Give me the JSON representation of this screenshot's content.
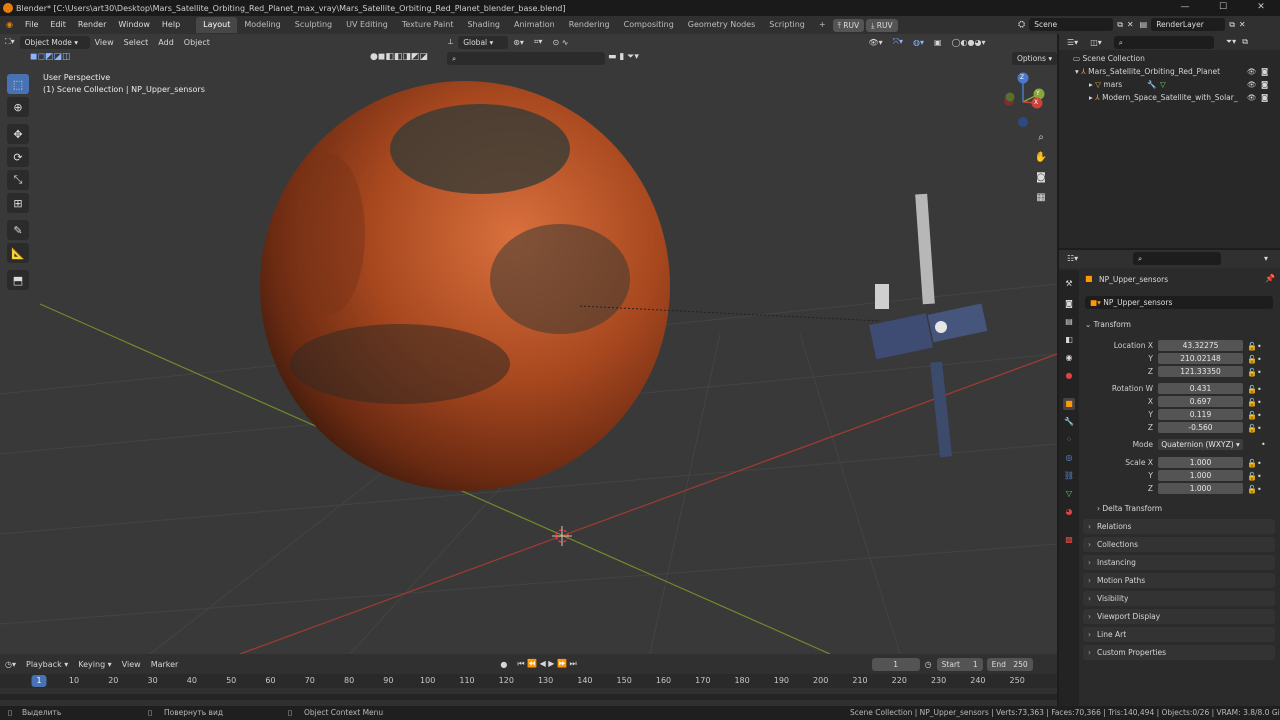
{
  "window": {
    "title": "Blender* [C:\\Users\\art30\\Desktop\\Mars_Satellite_Orbiting_Red_Planet_max_vray\\Mars_Satellite_Orbiting_Red_Planet_blender_base.blend]",
    "minimize": "—",
    "maximize": "☐",
    "close": "✕"
  },
  "menu": {
    "items": [
      "File",
      "Edit",
      "Render",
      "Window",
      "Help"
    ],
    "workspaces": [
      "Layout",
      "Modeling",
      "Sculpting",
      "UV Editing",
      "Texture Paint",
      "Shading",
      "Animation",
      "Rendering",
      "Compositing",
      "Geometry Nodes",
      "Scripting"
    ],
    "add_workspace": "+",
    "ruv1": "RUV",
    "ruv2": "RUV",
    "scene_label": "Scene",
    "render_layer": "RenderLayer"
  },
  "viewport": {
    "mode": "Object Mode",
    "menus": [
      "View",
      "Select",
      "Add",
      "Object"
    ],
    "transform_orientation": "Global",
    "options": "Options",
    "perspective": "User Perspective",
    "collection_info": "(1) Scene Collection | NP_Upper_sensors",
    "gizmo": {
      "x": "X",
      "y": "Y",
      "z": "Z"
    }
  },
  "outliner": {
    "scene_collection": "Scene Collection",
    "items": [
      {
        "label": "Mars_Satellite_Orbiting_Red_Planet"
      },
      {
        "label": "mars"
      },
      {
        "label": "Modern_Space_Satellite_with_Solar_"
      }
    ]
  },
  "properties": {
    "object_name": "NP_Upper_sensors",
    "data_name": "NP_Upper_sensors",
    "transform_header": "Transform",
    "location": {
      "label_x": "Location X",
      "label_y": "Y",
      "label_z": "Z",
      "x": "43.32275",
      "y": "210.02148",
      "z": "121.33350"
    },
    "rotation": {
      "label_w": "Rotation W",
      "label_x": "X",
      "label_y": "Y",
      "label_z": "Z",
      "w": "0.431",
      "x": "0.697",
      "y": "0.119",
      "z": "-0.560"
    },
    "mode_label": "Mode",
    "mode_value": "Quaternion (WXYZ)",
    "scale": {
      "label_x": "Scale X",
      "label_y": "Y",
      "label_z": "Z",
      "x": "1.000",
      "y": "1.000",
      "z": "1.000"
    },
    "delta_transform": "Delta Transform",
    "panels": [
      "Relations",
      "Collections",
      "Instancing",
      "Motion Paths",
      "Visibility",
      "Viewport Display",
      "Line Art",
      "Custom Properties"
    ]
  },
  "timeline": {
    "menus": [
      "Playback",
      "Keying",
      "View",
      "Marker"
    ],
    "current_frame": "1",
    "start_label": "Start",
    "start": "1",
    "end_label": "End",
    "end": "250",
    "ticks": [
      "10",
      "20",
      "30",
      "40",
      "50",
      "60",
      "70",
      "80",
      "90",
      "100",
      "110",
      "120",
      "130",
      "140",
      "150",
      "160",
      "170",
      "180",
      "190",
      "200",
      "210",
      "220",
      "230",
      "240",
      "250"
    ],
    "playhead": "1"
  },
  "statusbar": {
    "select": "Выделить",
    "rotate": "Повернуть вид",
    "context_menu": "Object Context Menu",
    "stats": "Scene Collection | NP_Upper_sensors | Verts:73,363 | Faces:70,366 | Tris:140,494 | Objects:0/26 | VRAM: 3.8/8.0 GiB | 3.6.11"
  },
  "colors": {
    "accent": "#4772b3",
    "x_axis": "#c0392b",
    "y_axis": "#7a9a2a",
    "mars": "#b5512a"
  }
}
